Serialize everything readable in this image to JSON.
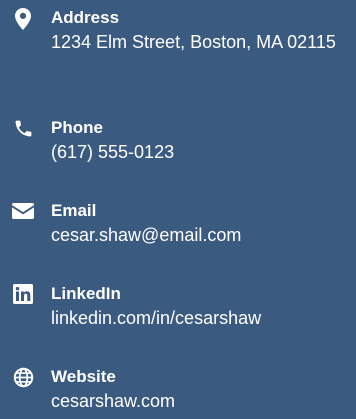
{
  "contacts": {
    "address": {
      "label": "Address",
      "value": "1234 Elm Street, Boston, MA 02115",
      "icon": "map-marker-icon"
    },
    "phone": {
      "label": "Phone",
      "value": "(617) 555-0123",
      "icon": "phone-icon"
    },
    "email": {
      "label": "Email",
      "value": "cesar.shaw@email.com",
      "icon": "envelope-icon"
    },
    "linkedin": {
      "label": "LinkedIn",
      "value": "linkedin.com/in/cesarshaw",
      "icon": "linkedin-icon"
    },
    "website": {
      "label": "Website",
      "value": "cesarshaw.com",
      "icon": "globe-icon"
    }
  },
  "colors": {
    "background": "#3b5a80",
    "text": "#ffffff"
  }
}
